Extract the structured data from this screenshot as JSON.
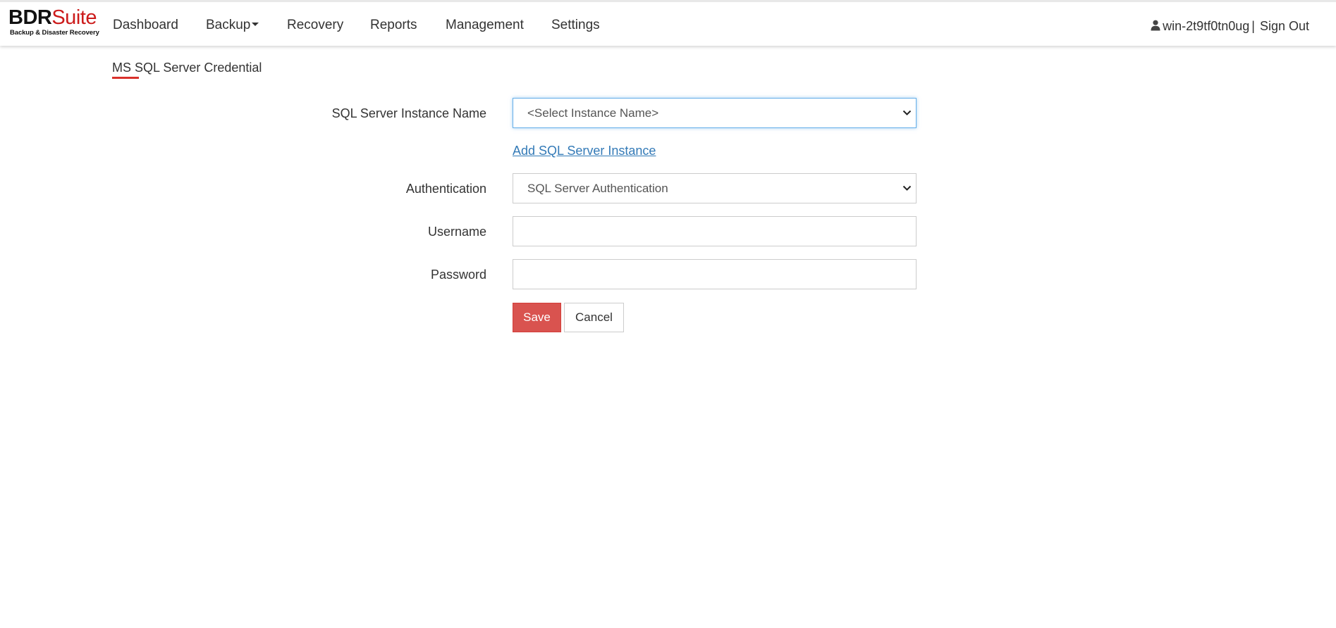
{
  "logo": {
    "brand_bold": "BDR",
    "brand_suite": "Suite",
    "tagline": "Backup & Disaster Recovery"
  },
  "nav": {
    "dashboard": "Dashboard",
    "backup": "Backup",
    "recovery": "Recovery",
    "reports": "Reports",
    "management": "Management",
    "settings": "Settings"
  },
  "user": {
    "icon": "user-icon",
    "name": "win-2t9tf0tn0ug",
    "separator": "|",
    "signout": "Sign Out"
  },
  "page": {
    "title": "MS SQL Server Credential"
  },
  "form": {
    "instance_label": "SQL Server Instance Name",
    "instance_value": "<Select Instance Name>",
    "add_instance_link": "Add SQL Server Instance",
    "auth_label": "Authentication",
    "auth_value": "SQL Server Authentication",
    "username_label": "Username",
    "username_value": "",
    "password_label": "Password",
    "password_value": "",
    "save_label": "Save",
    "cancel_label": "Cancel"
  },
  "colors": {
    "brand_red": "#cc1b1b",
    "save_button": "#d9534f",
    "link_blue": "#337ab7",
    "focus_border": "#66afe9",
    "title_underline": "#d9312b"
  }
}
